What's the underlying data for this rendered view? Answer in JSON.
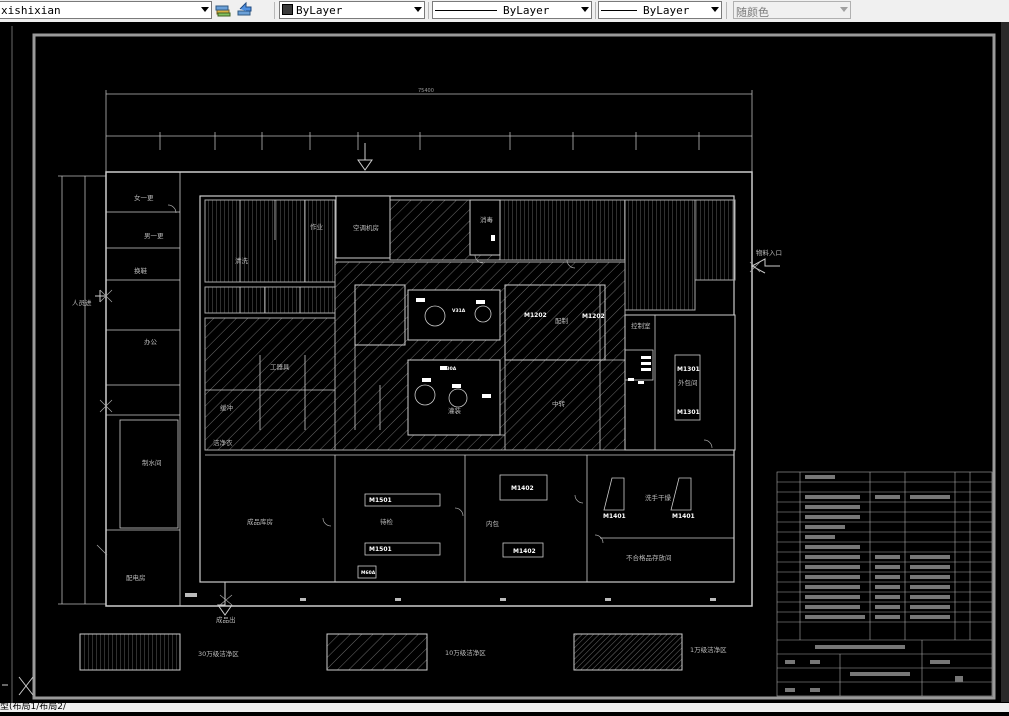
{
  "toolbar": {
    "layer_name": "xishixian",
    "color": "ByLayer",
    "linetype": "ByLayer",
    "lineweight": "ByLayer",
    "plotstyle": "随颜色"
  },
  "drawing": {
    "rooms": {
      "nv_gengyi": "女一更",
      "nan_gengyi": "男一更",
      "huanxie": "换鞋",
      "renyuanjin": "人员进",
      "bangong": "办公",
      "zhishuijian": "制水间",
      "peidianfang": "配电房",
      "chengpinchu": "成品出",
      "wuliao_rukou": "物料入口",
      "chengpin_kufang": "成品库房",
      "dengkan": "待检",
      "baozhuang": "内包",
      "dongshi": "洗手干燥",
      "buhege": "不合格品存放间",
      "kongtiao": "空调机房",
      "kongzhi": "控制室",
      "xiaodu": "消毒",
      "zhongzhuan": "中转",
      "huanchong": "缓冲",
      "waibao": "外包间",
      "peizhi": "配制",
      "guanzhuang": "灌装",
      "qingxi": "清洗",
      "gongyong": "工器具",
      "zuoye": "作业",
      "yifu": "洁净衣"
    },
    "tags": [
      "M1202",
      "M1202",
      "M1301",
      "M1301",
      "M1402",
      "M1402",
      "M1501",
      "M1501",
      "M1401",
      "M1401",
      "V31A",
      "V30A",
      "M60A"
    ],
    "legend": [
      {
        "label": "30万级洁净区"
      },
      {
        "label": "10万级洁净区"
      },
      {
        "label": "1万级洁净区"
      }
    ],
    "dimension_total": "75400"
  },
  "command": {
    "text": "型(布局1/布局2/"
  }
}
